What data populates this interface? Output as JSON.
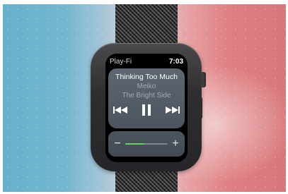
{
  "watch": {
    "app_title": "Play-Fi",
    "time": "7:03"
  },
  "now_playing": {
    "title": "Thinking Too Much",
    "artist": "Meiko",
    "album": "The Bright Side"
  },
  "controls": {
    "previous_icon": "previous-track-icon",
    "pause_icon": "pause-icon",
    "next_icon": "next-track-icon"
  },
  "volume": {
    "minus_label": "−",
    "plus_label": "+",
    "level_fraction": 0.45,
    "fill_color": "#5fd35a"
  },
  "colors": {
    "background_left": "#67b0cb",
    "background_right": "#d8777a"
  }
}
